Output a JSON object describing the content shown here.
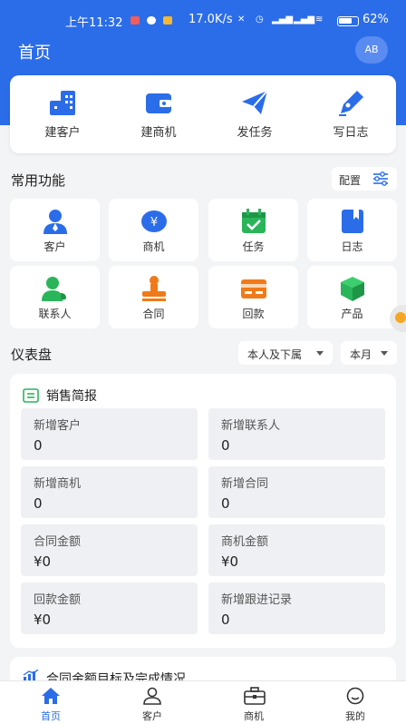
{
  "status_bar": {
    "time": "上午11:32",
    "net_speed": "17.0K/s",
    "battery": "62%"
  },
  "header": {
    "title": "首页",
    "avatar": "AB"
  },
  "quick_actions": [
    {
      "label": "建客户",
      "icon": "building-icon"
    },
    {
      "label": "建商机",
      "icon": "wallet-icon"
    },
    {
      "label": "发任务",
      "icon": "paper-plane-icon"
    },
    {
      "label": "写日志",
      "icon": "pen-icon"
    }
  ],
  "common": {
    "title": "常用功能",
    "config_label": "配置",
    "items": [
      {
        "label": "客户",
        "icon": "customer-icon"
      },
      {
        "label": "商机",
        "icon": "yen-coin-icon"
      },
      {
        "label": "任务",
        "icon": "calendar-check-icon"
      },
      {
        "label": "日志",
        "icon": "notebook-icon"
      },
      {
        "label": "联系人",
        "icon": "contact-phone-icon"
      },
      {
        "label": "合同",
        "icon": "stamp-icon"
      },
      {
        "label": "回款",
        "icon": "card-icon"
      },
      {
        "label": "产品",
        "icon": "cube-icon"
      }
    ]
  },
  "dashboard": {
    "title": "仪表盘",
    "scope": "本人及下属",
    "period": "本月",
    "sales_brief": {
      "title": "销售简报",
      "stats": [
        {
          "label": "新增客户",
          "value": "0"
        },
        {
          "label": "新增联系人",
          "value": "0"
        },
        {
          "label": "新增商机",
          "value": "0"
        },
        {
          "label": "新增合同",
          "value": "0"
        },
        {
          "label": "合同金额",
          "value": "¥0"
        },
        {
          "label": "商机金额",
          "value": "¥0"
        },
        {
          "label": "回款金额",
          "value": "¥0"
        },
        {
          "label": "新增跟进记录",
          "value": "0"
        }
      ]
    },
    "contract_target": {
      "title": "合同金额目标及完成情况"
    }
  },
  "tabbar": [
    {
      "label": "首页",
      "icon": "home-icon",
      "active": true
    },
    {
      "label": "客户",
      "icon": "person-icon",
      "active": false
    },
    {
      "label": "商机",
      "icon": "briefcase-icon",
      "active": false
    },
    {
      "label": "我的",
      "icon": "smiley-icon",
      "active": false
    }
  ],
  "colors": {
    "primary": "#2b6de9",
    "green": "#2bb55a",
    "orange": "#f07a1a",
    "page_bg": "#f3f4f6"
  }
}
